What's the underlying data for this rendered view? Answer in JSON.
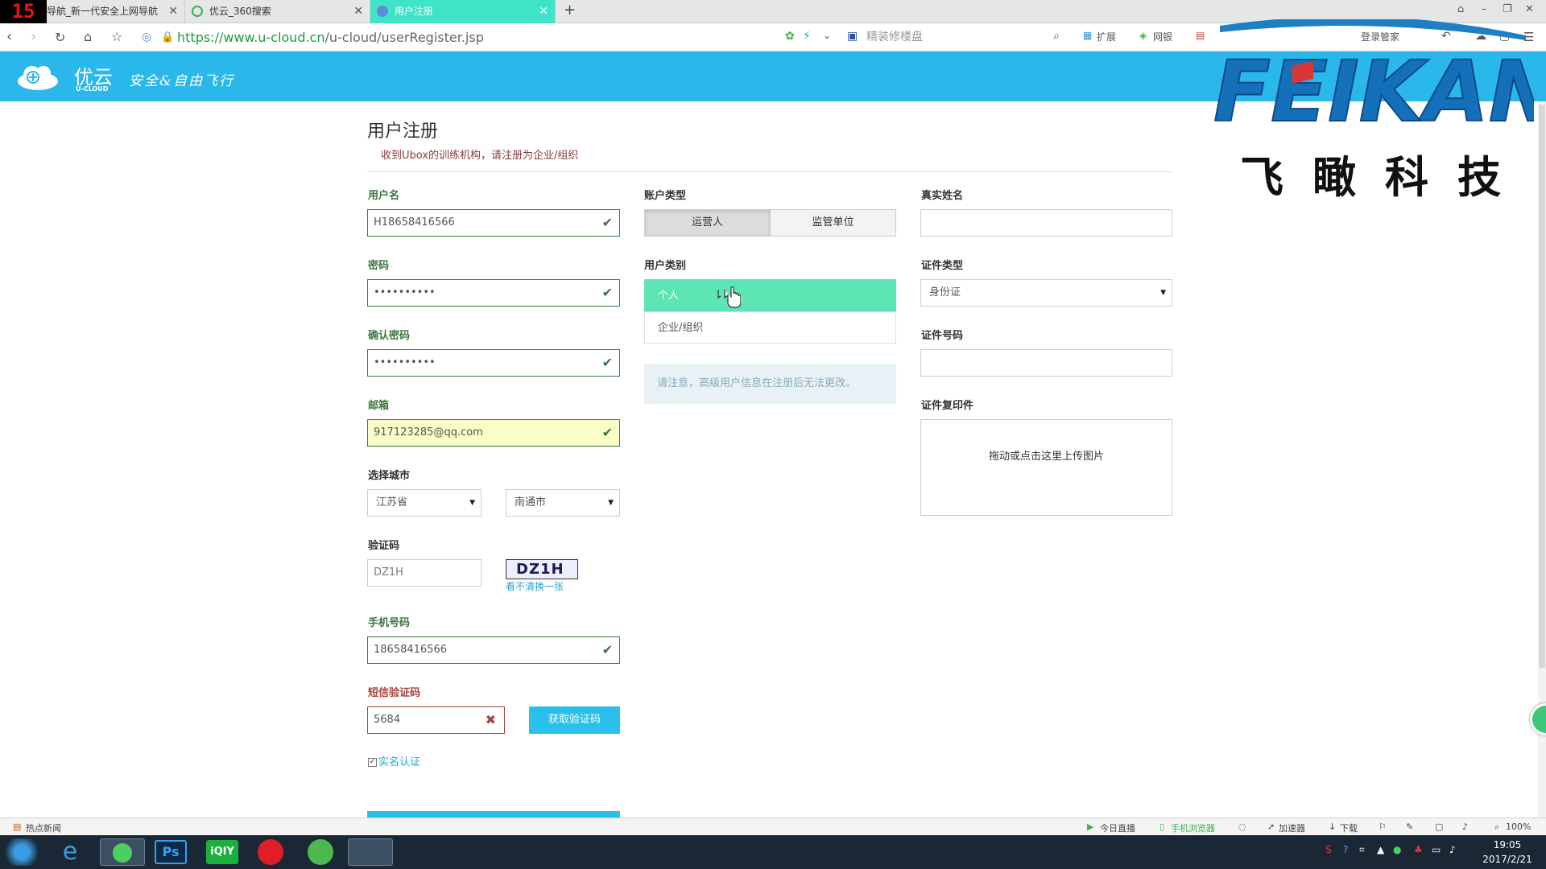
{
  "browser": {
    "badge": "15",
    "tabs": [
      {
        "label": "导航_新一代安全上网导航"
      },
      {
        "label": "优云_360搜索"
      },
      {
        "label": "用户注册"
      }
    ],
    "url_host": "https://www.u-cloud.cn",
    "url_path": "/u-cloud/userRegister.jsp",
    "search_placeholder": "精装修楼盘",
    "toolbar": {
      "extend": "扩展",
      "netbank": "网银",
      "login": "登录管家"
    }
  },
  "header": {
    "logo_text": "优云",
    "logo_sub": "U-CLOUD",
    "slogan": "安全&自由飞行"
  },
  "form": {
    "title": "用户注册",
    "notice": "收到Ubox的训练机构，请注册为企业/组织",
    "username_label": "用户名",
    "username_value": "H18658416566",
    "password_label": "密码",
    "password_value": "••••••••••",
    "confirm_label": "确认密码",
    "confirm_value": "••••••••••",
    "email_label": "邮箱",
    "email_value": "917123285@qq.com",
    "city_label": "选择城市",
    "province_value": "江苏省",
    "city_value": "南通市",
    "captcha_label": "验证码",
    "captcha_input": "DZ1H",
    "captcha_image_text": "DZ1H",
    "captcha_refresh": "看不清换一张",
    "phone_label": "手机号码",
    "phone_value": "18658416566",
    "sms_label": "短信验证码",
    "sms_value": "5684",
    "sms_button": "获取验证码",
    "realname_check": "实名认证",
    "account_type_label": "账户类型",
    "account_types": [
      "运营人",
      "监管单位"
    ],
    "user_category_label": "用户类别",
    "user_categories": [
      "个人",
      "企业/组织"
    ],
    "info_text": "请注意，高级用户信息在注册后无法更改。",
    "real_name_label": "真实姓名",
    "id_type_label": "证件类型",
    "id_type_value": "身份证",
    "id_number_label": "证件号码",
    "id_copy_label": "证件复印件",
    "upload_text": "拖动或点击这里上传图片"
  },
  "watermark": {
    "latin": "FEIKAN",
    "chinese": "飞瞰科技"
  },
  "statusbar": {
    "news": "热点新闻",
    "live": "今日直播",
    "mobile": "手机浏览器",
    "accelerator": "加速器",
    "download": "下载",
    "zoom": "100%"
  },
  "taskbar": {
    "time": "19:05",
    "date": "2017/2/21"
  }
}
